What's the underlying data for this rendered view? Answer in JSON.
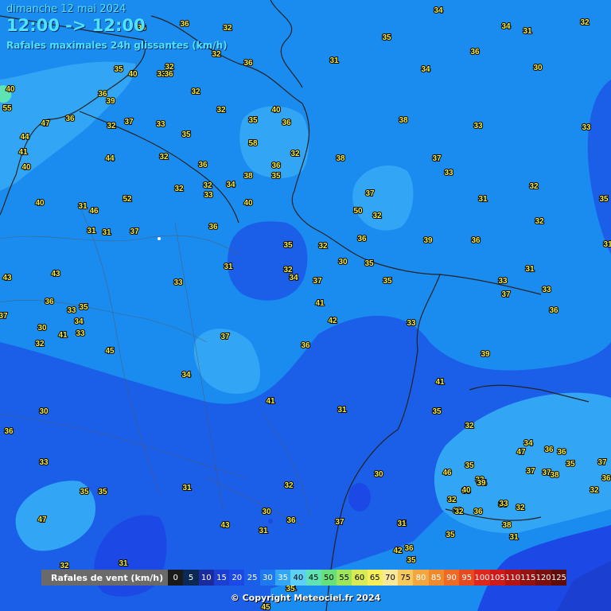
{
  "header": {
    "date": "dimanche 12 mai 2024",
    "time_range": "12:00 -> 12:00",
    "title": "Rafales maximales 24h glissantes (km/h)"
  },
  "legend": {
    "label": "Rafales de vent (km/h)",
    "bins": [
      {
        "value": "0",
        "color": "#1a1a1a"
      },
      {
        "value": "5",
        "color": "#0a2a55"
      },
      {
        "value": "10",
        "color": "#1a2b9e"
      },
      {
        "value": "15",
        "color": "#1b3fd0"
      },
      {
        "value": "20",
        "color": "#1c49e6"
      },
      {
        "value": "25",
        "color": "#1b5fe8"
      },
      {
        "value": "30",
        "color": "#1e78f0"
      },
      {
        "value": "35",
        "color": "#32a6f5"
      },
      {
        "value": "40",
        "color": "#5cd0f7"
      },
      {
        "value": "45",
        "color": "#5fe3b4"
      },
      {
        "value": "50",
        "color": "#66e07a"
      },
      {
        "value": "55",
        "color": "#9de65a"
      },
      {
        "value": "60",
        "color": "#d8ea55"
      },
      {
        "value": "65",
        "color": "#f6ef5b"
      },
      {
        "value": "70",
        "color": "#f8e89a"
      },
      {
        "value": "75",
        "color": "#f4c85c"
      },
      {
        "value": "80",
        "color": "#f2a63d"
      },
      {
        "value": "85",
        "color": "#ef8a2c"
      },
      {
        "value": "90",
        "color": "#ee6a25"
      },
      {
        "value": "95",
        "color": "#e84a20"
      },
      {
        "value": "100",
        "color": "#e0271c"
      },
      {
        "value": "105",
        "color": "#cf1a1a"
      },
      {
        "value": "110",
        "color": "#b31515"
      },
      {
        "value": "115",
        "color": "#951212"
      },
      {
        "value": "120",
        "color": "#7a0f0f"
      },
      {
        "value": "125",
        "color": "#5e0c0c"
      }
    ]
  },
  "stations": [
    {
      "v": "34"
    },
    {
      "v": "36"
    },
    {
      "v": "32"
    },
    {
      "v": "36"
    },
    {
      "v": "34"
    },
    {
      "v": "31"
    },
    {
      "v": "32"
    },
    {
      "v": "35"
    },
    {
      "v": "32"
    },
    {
      "v": "31"
    },
    {
      "v": "36"
    },
    {
      "v": "36"
    },
    {
      "v": "34"
    },
    {
      "v": "30"
    },
    {
      "v": "40"
    },
    {
      "v": "32"
    },
    {
      "v": "33"
    },
    {
      "v": "36"
    },
    {
      "v": "35"
    },
    {
      "v": "39"
    },
    {
      "v": "32"
    },
    {
      "v": "40"
    },
    {
      "v": "55"
    },
    {
      "v": "36"
    },
    {
      "v": "32"
    },
    {
      "v": "32"
    },
    {
      "v": "37"
    },
    {
      "v": "33"
    },
    {
      "v": "47"
    },
    {
      "v": "36"
    },
    {
      "v": "35"
    },
    {
      "v": "40"
    },
    {
      "v": "36"
    },
    {
      "v": "38"
    },
    {
      "v": "33"
    },
    {
      "v": "33"
    },
    {
      "v": "44"
    },
    {
      "v": "35"
    },
    {
      "v": "58"
    },
    {
      "v": "32"
    },
    {
      "v": "41"
    },
    {
      "v": "44"
    },
    {
      "v": "32"
    },
    {
      "v": "36"
    },
    {
      "v": "38"
    },
    {
      "v": "37"
    },
    {
      "v": "33"
    },
    {
      "v": "40"
    },
    {
      "v": "36"
    },
    {
      "v": "35"
    },
    {
      "v": "32"
    },
    {
      "v": "34"
    },
    {
      "v": "33"
    },
    {
      "v": "38"
    },
    {
      "v": "32"
    },
    {
      "v": "52"
    },
    {
      "v": "37"
    },
    {
      "v": "31"
    },
    {
      "v": "35"
    },
    {
      "v": "40"
    },
    {
      "v": "31"
    },
    {
      "v": "40"
    },
    {
      "v": "46"
    },
    {
      "v": "50"
    },
    {
      "v": "32"
    },
    {
      "v": "32"
    },
    {
      "v": "31"
    },
    {
      "v": "31"
    },
    {
      "v": "37"
    },
    {
      "v": "36"
    },
    {
      "v": "32"
    },
    {
      "v": "36"
    },
    {
      "v": "39"
    },
    {
      "v": "36"
    },
    {
      "v": "31"
    },
    {
      "v": "35"
    },
    {
      "v": "30"
    },
    {
      "v": "31"
    },
    {
      "v": "32"
    },
    {
      "v": "32"
    },
    {
      "v": "35"
    },
    {
      "v": "33"
    },
    {
      "v": "43"
    },
    {
      "v": "43"
    },
    {
      "v": "34"
    },
    {
      "v": "37"
    },
    {
      "v": "35"
    },
    {
      "v": "31"
    },
    {
      "v": "33"
    },
    {
      "v": "33"
    },
    {
      "v": "37"
    },
    {
      "v": "36"
    },
    {
      "v": "41"
    },
    {
      "v": "33"
    },
    {
      "v": "35"
    },
    {
      "v": "36"
    },
    {
      "v": "37"
    },
    {
      "v": "34"
    },
    {
      "v": "30"
    },
    {
      "v": "41"
    },
    {
      "v": "33"
    },
    {
      "v": "42"
    },
    {
      "v": "33"
    },
    {
      "v": "32"
    },
    {
      "v": "37"
    },
    {
      "v": "45"
    },
    {
      "v": "36"
    },
    {
      "v": "39"
    },
    {
      "v": "34"
    },
    {
      "v": "41"
    },
    {
      "v": "41"
    },
    {
      "v": "30"
    },
    {
      "v": "31"
    },
    {
      "v": "35"
    },
    {
      "v": "36"
    },
    {
      "v": "35"
    },
    {
      "v": "32"
    },
    {
      "v": "33"
    },
    {
      "v": "31"
    },
    {
      "v": "34"
    },
    {
      "v": "36"
    },
    {
      "v": "47"
    },
    {
      "v": "35"
    },
    {
      "v": "35"
    },
    {
      "v": "37"
    },
    {
      "v": "36"
    },
    {
      "v": "37"
    },
    {
      "v": "32"
    },
    {
      "v": "30"
    },
    {
      "v": "46"
    },
    {
      "v": "32"
    },
    {
      "v": "33"
    },
    {
      "v": "34"
    },
    {
      "v": "37"
    },
    {
      "v": "38"
    },
    {
      "v": "38"
    },
    {
      "v": "39"
    },
    {
      "v": "33"
    },
    {
      "v": "36"
    },
    {
      "v": "35"
    },
    {
      "v": "30"
    },
    {
      "v": "40"
    },
    {
      "v": "32"
    },
    {
      "v": "33"
    },
    {
      "v": "32"
    },
    {
      "v": "36"
    },
    {
      "v": "32"
    },
    {
      "v": "36"
    },
    {
      "v": "33"
    },
    {
      "v": "47"
    },
    {
      "v": "31"
    },
    {
      "v": "35"
    },
    {
      "v": "43"
    },
    {
      "v": "37"
    },
    {
      "v": "31"
    },
    {
      "v": "35"
    },
    {
      "v": "38"
    },
    {
      "v": "31"
    },
    {
      "v": "31"
    },
    {
      "v": "42"
    },
    {
      "v": "36"
    },
    {
      "v": "35"
    },
    {
      "v": "32"
    },
    {
      "v": "31"
    },
    {
      "v": "35"
    },
    {
      "v": "45"
    }
  ],
  "copyright": "© Copyright Meteociel.fr 2024"
}
